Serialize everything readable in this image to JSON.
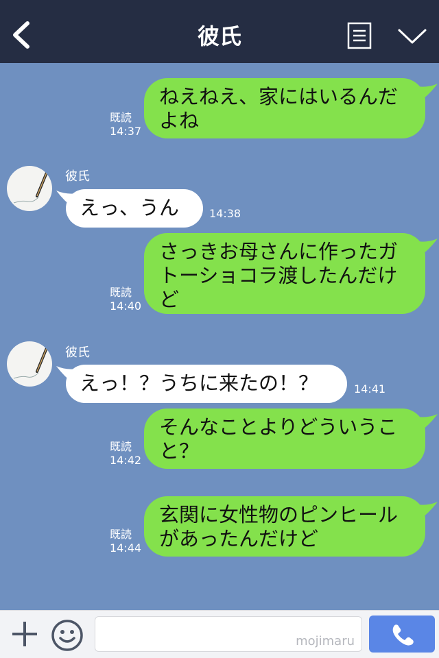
{
  "header": {
    "title": "彼氏",
    "back_icon": "chevron-left-icon",
    "menu_icon": "list-menu-icon",
    "collapse_icon": "chevron-down-icon",
    "background": "#252d43"
  },
  "chat": {
    "background": "#6f90c0",
    "outgoing_color": "#84e14c",
    "incoming_color": "#ffffff",
    "messages": [
      {
        "direction": "out",
        "lines": [
          "ねえねえ、家にはいるんだ",
          "よね"
        ],
        "read": "既読",
        "time": "14:37"
      },
      {
        "direction": "in",
        "sender": "彼氏",
        "lines": [
          "えっ、うん"
        ],
        "time": "14:38"
      },
      {
        "direction": "out",
        "lines": [
          "さっきお母さんに作ったガ",
          "トーショコラ渡したんだけ",
          "ど"
        ],
        "read": "既読",
        "time": "14:40"
      },
      {
        "direction": "in",
        "sender": "彼氏",
        "lines": [
          "えっ！？うちに来たの！？"
        ],
        "time": "14:41"
      },
      {
        "direction": "out",
        "lines": [
          "そんなことよりどういうこ",
          "と？"
        ],
        "read": "既読",
        "time": "14:42"
      },
      {
        "direction": "out",
        "lines": [
          "玄関に女性物のピンヒール",
          "があったんだけど"
        ],
        "read": "既読",
        "time": "14:44"
      }
    ]
  },
  "inputbar": {
    "plus_icon": "plus-icon",
    "emoji_icon": "smiley-icon",
    "watermark": "mojimaru",
    "call_icon": "phone-icon",
    "call_color": "#5a86e6"
  }
}
